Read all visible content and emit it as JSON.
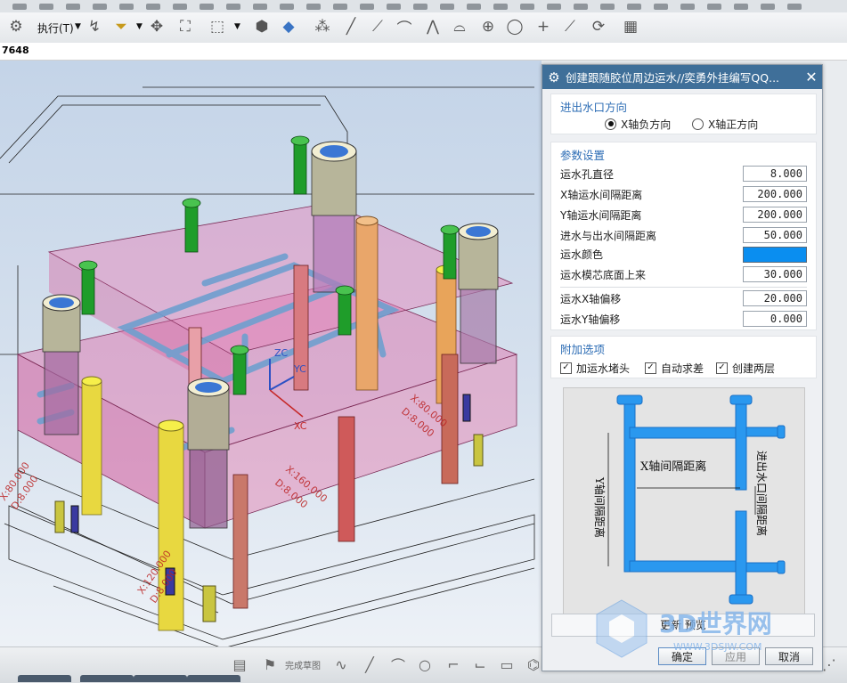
{
  "toolbar": {
    "execute_label": "执行(T)",
    "icons": [
      "assembly-icon",
      "execute-menu",
      "snap-icon",
      "filter-icon",
      "point-icon",
      "component-icon",
      "select-box-icon",
      "box-icon",
      "cube-icon",
      "scatter-icon",
      "line-icon",
      "arc-icon",
      "polyline-icon",
      "fillet-icon",
      "circle-icon",
      "ring-icon",
      "plus-icon",
      "slash-icon",
      "rotate-icon",
      "grid-icon"
    ]
  },
  "coordbar": {
    "value": "7648"
  },
  "viewport": {
    "labels": {
      "zc": "ZC",
      "yc": "YC",
      "xc": "XC",
      "dim1": "X:80.000",
      "dim1b": "D:8.000",
      "dim2": "X:120.000",
      "dim2b": "D:8.000",
      "dim3": "X:160.000",
      "dim3b": "D:8.000",
      "dim4": "X:80.000",
      "dim4b": "D:8.000"
    }
  },
  "dialog": {
    "title": "创建跟随胶位周边运水//奕勇外挂编写QQ...",
    "direction_group": {
      "heading": "进出水口方向",
      "options": [
        "X轴负方向",
        "X轴正方向"
      ],
      "selected": 0
    },
    "params_group": {
      "heading": "参数设置",
      "rows": [
        {
          "label": "运水孔直径",
          "value": "8.000"
        },
        {
          "label": "X轴运水间隔距离",
          "value": "200.000"
        },
        {
          "label": "Y轴运水间隔距离",
          "value": "200.000"
        },
        {
          "label": "进水与出水间隔距离",
          "value": "50.000"
        },
        {
          "label": "运水颜色",
          "value": ""
        },
        {
          "label": "运水模芯底面上来",
          "value": "30.000"
        },
        {
          "label": "运水X轴偏移",
          "value": "20.000"
        },
        {
          "label": "运水Y轴偏移",
          "value": "0.000"
        }
      ],
      "color_swatch": "#0a8ef0"
    },
    "extra_group": {
      "heading": "附加选项",
      "checks": [
        {
          "label": "加运水堵头",
          "checked": true
        },
        {
          "label": "自动求差",
          "checked": true
        },
        {
          "label": "创建两层",
          "checked": true
        }
      ]
    },
    "preview": {
      "x_label": "X轴间隔距离",
      "y_label": "Y轴间隔距离",
      "inout_label": "进出水口间隔距离"
    },
    "update_label": "更新 预览",
    "buttons": {
      "ok": "确定",
      "apply": "应用",
      "cancel": "取消"
    }
  },
  "bottombar": {
    "finish_sketch": "完成草图"
  },
  "watermark": {
    "text": "3D世界网",
    "url": "WWW.3DSJW.COM"
  }
}
